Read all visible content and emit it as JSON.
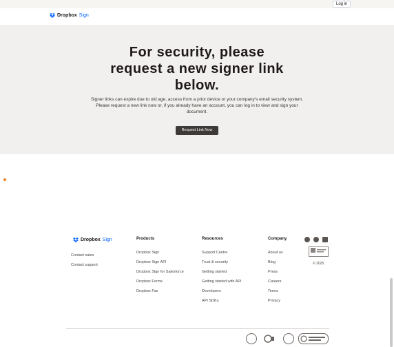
{
  "header": {
    "login_label": "Log in",
    "logo_brand": "Dropbox",
    "logo_product": "Sign"
  },
  "hero": {
    "title_line1": "For security, please",
    "title_line2": "request a new signer link",
    "title_line3": "below.",
    "body_line1": "Signer links can expire due to old age, access from a prior device or your company's email security system.",
    "body_line2": "Please request a new link now or, if you already have an account, you can log in to view and sign your",
    "body_line3": "document.",
    "button_label": "Request Link Now"
  },
  "footer": {
    "logo_brand": "Dropbox",
    "logo_product": "Sign",
    "contact": [
      "Contact sales",
      "Contact support"
    ],
    "products": {
      "heading": "Products",
      "links": [
        "Dropbox Sign",
        "Dropbox Sign API",
        "Dropbox Sign for Salesforce",
        "Dropbox Forms",
        "Dropbox Fax"
      ]
    },
    "resources": {
      "heading": "Resources",
      "links": [
        "Support Centre",
        "Trust & security",
        "Getting started",
        "Getting started with API",
        "Developers",
        "API SDKs"
      ]
    },
    "company": {
      "heading": "Company",
      "links": [
        "About us",
        "Blog",
        "Press",
        "Careers",
        "Terms",
        "Privacy"
      ]
    },
    "social_icons": [
      "facebook-icon",
      "twitter-icon",
      "linkedin-icon"
    ],
    "copyright": "© 2025"
  },
  "colors": {
    "hero_bg": "#f1f0ee",
    "button_bg": "#3d3a38",
    "brand_blue": "#0061fe",
    "accent_orange": "#f5821f"
  }
}
